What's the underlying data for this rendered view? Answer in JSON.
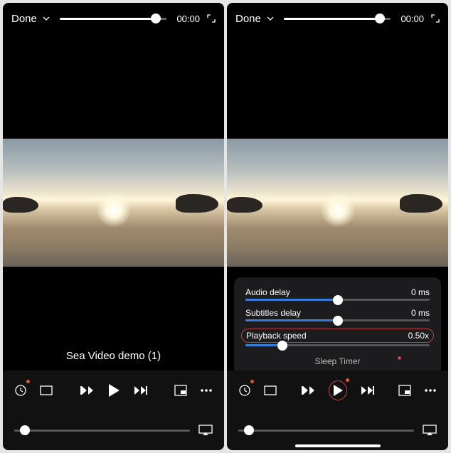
{
  "left": {
    "done": "Done",
    "time": "00:00",
    "title": "Sea Video demo (1)"
  },
  "right": {
    "done": "Done",
    "time": "00:00",
    "panel": {
      "audio_label": "Audio delay",
      "audio_value": "0 ms",
      "audio_pct": 50,
      "subs_label": "Subtitles delay",
      "subs_value": "0 ms",
      "subs_pct": 50,
      "speed_label": "Playback speed",
      "speed_value": "0.50x",
      "speed_pct": 20,
      "sleep_label": "Sleep Timer"
    }
  },
  "chart_data": {
    "type": "table",
    "note": "Playback settings panel values (right screenshot)",
    "rows": [
      {
        "label": "Audio delay",
        "value": "0 ms"
      },
      {
        "label": "Subtitles delay",
        "value": "0 ms"
      },
      {
        "label": "Playback speed",
        "value": "0.50x"
      }
    ]
  }
}
